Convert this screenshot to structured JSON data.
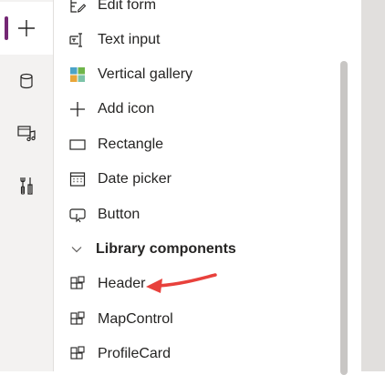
{
  "rail": {
    "items": [
      {
        "icon": "plus-icon",
        "active": true
      },
      {
        "icon": "database-icon",
        "active": false
      },
      {
        "icon": "media-icon",
        "active": false
      },
      {
        "icon": "tools-icon",
        "active": false
      }
    ],
    "accent": "#742774"
  },
  "panel": {
    "items": [
      {
        "label": "Edit form",
        "icon": "edit-form-icon"
      },
      {
        "label": "Text input",
        "icon": "text-input-icon"
      },
      {
        "label": "Vertical gallery",
        "icon": "vertical-gallery-icon"
      },
      {
        "label": "Add icon",
        "icon": "plus-icon"
      },
      {
        "label": "Rectangle",
        "icon": "rectangle-icon"
      },
      {
        "label": "Date picker",
        "icon": "calendar-icon"
      },
      {
        "label": "Button",
        "icon": "button-icon"
      }
    ],
    "section": {
      "label": "Library components",
      "icon": "chevron-down-icon"
    },
    "components": [
      {
        "label": "Header",
        "icon": "component-icon"
      },
      {
        "label": "MapControl",
        "icon": "component-icon"
      },
      {
        "label": "ProfileCard",
        "icon": "component-icon"
      }
    ]
  },
  "annotation": {
    "color": "#e8413c",
    "icon": "red-arrow"
  }
}
